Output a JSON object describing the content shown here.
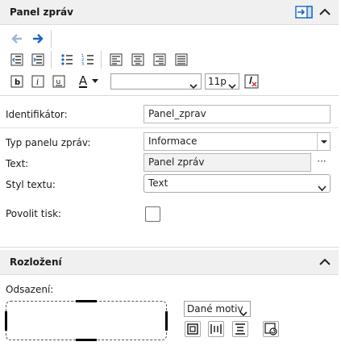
{
  "panel_section": {
    "title": "Panel zpráv",
    "pin_icon": "dock-panel-icon",
    "collapse_icon": "chevron-up-icon"
  },
  "toolbar": {
    "undo_icon": "arrow-left-icon",
    "redo_icon": "arrow-right-icon",
    "font_name": "",
    "font_size": "11p",
    "font_color_label": "A"
  },
  "properties": {
    "identifier": {
      "label": "Identifikátor:",
      "value": "Panel_zprav"
    },
    "panel_type": {
      "label": "Typ panelu zpráv:",
      "value": "Informace"
    },
    "text": {
      "label": "Text:",
      "value": "Panel zpráv",
      "button": "···"
    },
    "text_style": {
      "label": "Styl textu:",
      "value": "Text"
    },
    "allow_print": {
      "label": "Povolit tisk:",
      "checked": false
    }
  },
  "layout_section": {
    "title": "Rozložení",
    "margin_label": "Odsazení:",
    "theme_select": "Dané motiv"
  },
  "colors": {
    "header_bg": "#f0f0f0",
    "accent_blue": "#1565c0",
    "clear_red": "#d32f2f"
  }
}
